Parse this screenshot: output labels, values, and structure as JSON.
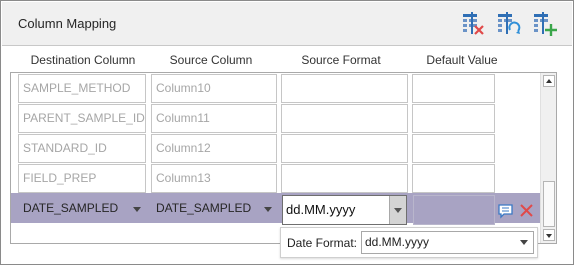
{
  "window": {
    "title": "Column Mapping"
  },
  "toolbar": {
    "buttons": [
      {
        "name": "remove-mappings",
        "icon": "table-delete-icon"
      },
      {
        "name": "refresh-mappings",
        "icon": "table-refresh-icon"
      },
      {
        "name": "add-mapping",
        "icon": "table-add-icon"
      }
    ]
  },
  "headers": {
    "destination": "Destination Column",
    "source": "Source Column",
    "format": "Source Format",
    "default": "Default Value"
  },
  "rows": [
    {
      "destination": "SAMPLE_METHOD",
      "source": "Column10",
      "format": "",
      "default": ""
    },
    {
      "destination": "PARENT_SAMPLE_ID",
      "source": "Column11",
      "format": "",
      "default": ""
    },
    {
      "destination": "STANDARD_ID",
      "source": "Column12",
      "format": "",
      "default": ""
    },
    {
      "destination": "FIELD_PREP",
      "source": "Column13",
      "format": "",
      "default": ""
    }
  ],
  "selected_row": {
    "destination": "DATE_SAMPLED",
    "source": "DATE_SAMPLED",
    "format": "dd.MM.yyyy",
    "default": ""
  },
  "popup": {
    "label": "Date Format:",
    "value": "dd.MM.yyyy"
  },
  "colors": {
    "selection": "#a8a3c3",
    "delete_icon": "#e04a4a",
    "comment_icon": "#3a78c4",
    "toolbar_icon": "#2f6fb5"
  }
}
